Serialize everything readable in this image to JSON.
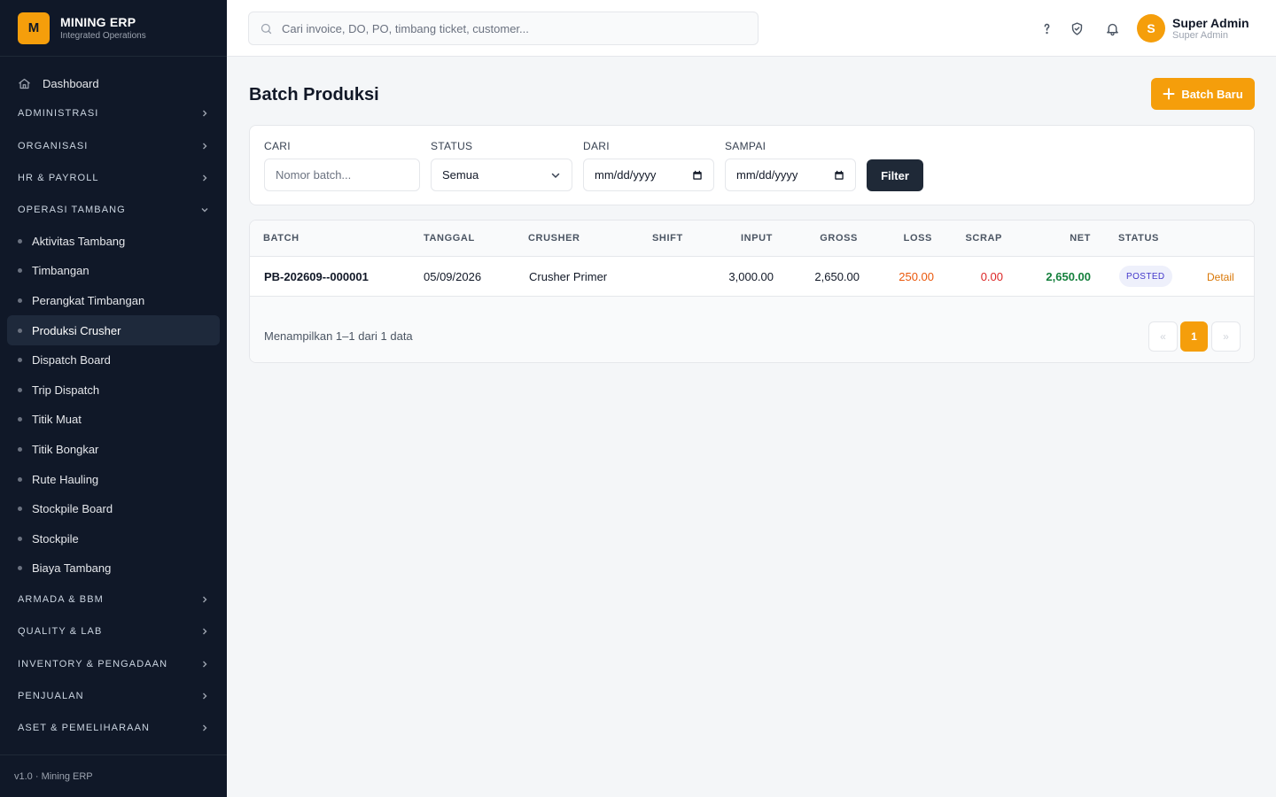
{
  "brand": {
    "logo_letter": "M",
    "title": "MINING ERP",
    "subtitle": "Integrated Operations"
  },
  "sidebar": {
    "dashboard_label": "Dashboard",
    "groups_before": [
      {
        "label": "ADMINISTRASI"
      },
      {
        "label": "ORGANISASI"
      },
      {
        "label": "HR & PAYROLL"
      }
    ],
    "open_group": {
      "label": "OPERASI TAMBANG",
      "items": [
        {
          "label": "Aktivitas Tambang"
        },
        {
          "label": "Timbangan"
        },
        {
          "label": "Perangkat Timbangan"
        },
        {
          "label": "Produksi Crusher",
          "active": true
        },
        {
          "label": "Dispatch Board"
        },
        {
          "label": "Trip Dispatch"
        },
        {
          "label": "Titik Muat"
        },
        {
          "label": "Titik Bongkar"
        },
        {
          "label": "Rute Hauling"
        },
        {
          "label": "Stockpile Board"
        },
        {
          "label": "Stockpile"
        },
        {
          "label": "Biaya Tambang"
        }
      ]
    },
    "groups_after": [
      {
        "label": "ARMADA & BBM"
      },
      {
        "label": "QUALITY & LAB"
      },
      {
        "label": "INVENTORY & PENGADAAN"
      },
      {
        "label": "PENJUALAN"
      },
      {
        "label": "ASET & PEMELIHARAAN"
      }
    ],
    "footer": "v1.0 · Mining ERP"
  },
  "header": {
    "search_placeholder": "Cari invoice, DO, PO, timbang ticket, customer...",
    "icons": [
      "help-icon",
      "shield-check-icon",
      "bell-icon"
    ],
    "user": {
      "initial": "S",
      "name": "Super Admin",
      "role": "Super Admin"
    }
  },
  "page": {
    "title": "Batch Produksi",
    "new_button": "Batch Baru"
  },
  "filters": {
    "search_label": "CARI",
    "search_placeholder": "Nomor batch...",
    "status_label": "STATUS",
    "status_value": "Semua",
    "from_label": "DARI",
    "from_placeholder": "mm/dd/yyyy",
    "to_label": "SAMPAI",
    "to_placeholder": "mm/dd/yyyy",
    "filter_button": "Filter"
  },
  "table": {
    "headers": {
      "batch": "BATCH",
      "tanggal": "TANGGAL",
      "crusher": "CRUSHER",
      "shift": "SHIFT",
      "input": "INPUT",
      "gross": "GROSS",
      "loss": "LOSS",
      "scrap": "SCRAP",
      "net": "NET",
      "status": "STATUS"
    },
    "rows": [
      {
        "batch": "PB-202609--000001",
        "tanggal": "05/09/2026",
        "crusher": "Crusher Primer",
        "shift": "",
        "input": "3,000.00",
        "gross": "2,650.00",
        "loss": "250.00",
        "scrap": "0.00",
        "net": "2,650.00",
        "status": "POSTED",
        "action": "Detail"
      }
    ],
    "summary": "Menampilkan 1–1 dari 1 data",
    "pagination": {
      "prev": "«",
      "current": "1",
      "next": "»"
    }
  },
  "colors": {
    "accent": "#f59e0b",
    "sidebar_bg": "#101828",
    "loss": "#ea580c",
    "scrap": "#dc2626",
    "net": "#15803d",
    "badge_bg": "#eef0fb"
  }
}
